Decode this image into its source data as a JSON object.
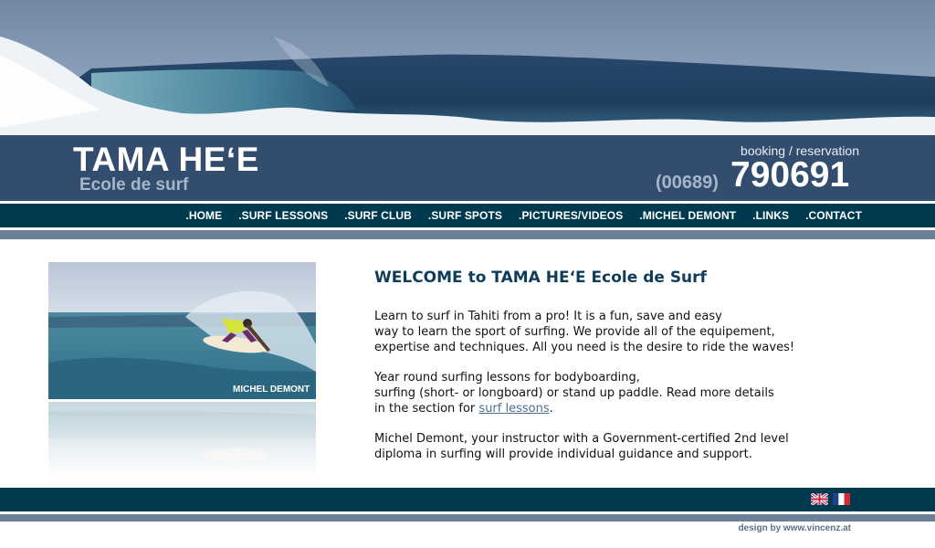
{
  "header": {
    "logo_title": "TAMA HE‘E",
    "logo_subtitle": "Ecole de surf",
    "booking_label": "booking / reservation",
    "phone_prefix": "(00689)",
    "phone_number": "790691"
  },
  "nav": {
    "items": [
      ".HOME",
      ".SURF LESSONS",
      ".SURF CLUB",
      ".SURF SPOTS",
      ".PICTURES/VIDEOS",
      ".MICHEL DEMONT",
      ".LINKS",
      ".CONTACT"
    ]
  },
  "photo": {
    "caption": "MICHEL DEMONT"
  },
  "content": {
    "welcome": "WELCOME to TAMA HE‘E Ecole de Surf",
    "p1_l1": "Learn to surf in Tahiti from a pro! It is a fun, save and easy",
    "p1_l2": "way to learn the sport of surfing. We provide all of the equipement,",
    "p1_l3": "expertise and techniques. All you need is the desire to ride the waves!",
    "p2_l1": "Year round surfing lessons for bodyboarding,",
    "p2_l2": "surfing (short- or longboard) or stand up paddle. Read more details",
    "p2_l3_pre": "in the section for ",
    "p2_link": "surf lessons",
    "p2_l3_post": ".",
    "p3_l1": "Michel Demont, your instructor with a Government-certified 2nd level",
    "p3_l2": "diploma in surfing will provide individual guidance and support."
  },
  "footer": {
    "credit": "design by www.vincenz.at",
    "languages": [
      "English",
      "Français"
    ]
  },
  "colors": {
    "header_bg": "#334d6e",
    "nav_bg": "#003a4e",
    "stripe": "#6a8096",
    "title": "#0e3d5a",
    "link": "#4a6e92"
  }
}
